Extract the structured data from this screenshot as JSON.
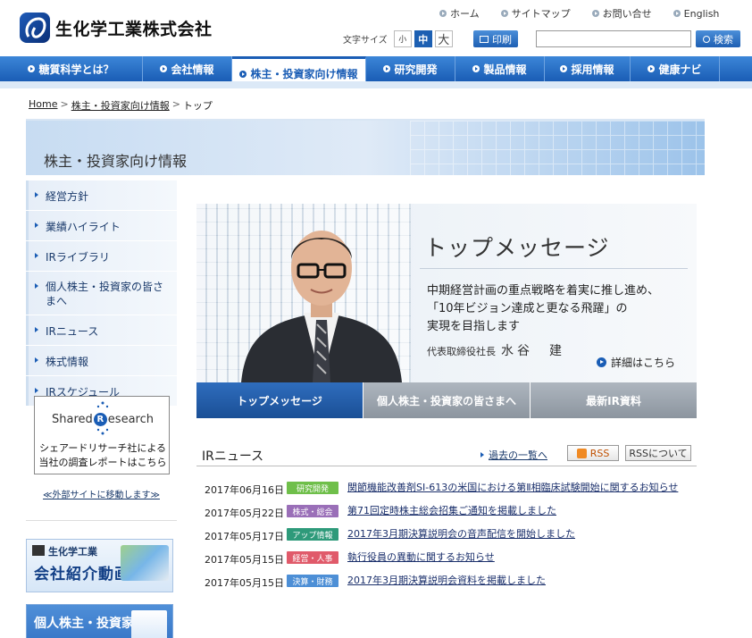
{
  "header": {
    "company_name": "生化学工業株式会社",
    "util_links": [
      {
        "label": "ホーム"
      },
      {
        "label": "サイトマップ"
      },
      {
        "label": "お問い合せ"
      },
      {
        "label": "English"
      }
    ],
    "font_size_label": "文字サイズ",
    "font_sizes": [
      "小",
      "中",
      "大"
    ],
    "print_label": "印刷",
    "search_placeholder": "",
    "search_button": "検索"
  },
  "gnav": {
    "items": [
      {
        "label": "糖質科学とは？"
      },
      {
        "label": "会社情報"
      },
      {
        "label": "株主・投資家向け情報"
      },
      {
        "label": "研究開発"
      },
      {
        "label": "製品情報"
      },
      {
        "label": "採用情報"
      },
      {
        "label": "健康ナビ"
      }
    ]
  },
  "breadcrumb": {
    "home": "Home",
    "parent": "株主・投資家向け情報",
    "current": "トップ",
    "separator": ">"
  },
  "page_title": "株主・投資家向け情報",
  "sidenav": {
    "items": [
      {
        "label": "経営方針"
      },
      {
        "label": "業績ハイライト"
      },
      {
        "label": "IRライブラリ"
      },
      {
        "label": "個人株主・投資家の皆さまへ"
      },
      {
        "label": "IRニュース"
      },
      {
        "label": "株式情報"
      },
      {
        "label": "IRスケジュール"
      }
    ]
  },
  "shared_research": {
    "logo_prefix": "Shared",
    "logo_r": "R",
    "logo_suffix": "esearch",
    "text_line1": "シェアードリサーチ社による",
    "text_line2": "当社の調査レポートはこちら",
    "external_note": "≪外部サイトに移動します≫"
  },
  "banners": {
    "video_line1": "生化学工業",
    "video_line2": "会社紹介動画",
    "investor_line1": "個人株主・投資家"
  },
  "main_visual": {
    "title": "トップメッセージ",
    "text_line1": "中期経営計画の重点戦略を着実に推し進め、",
    "text_line2": "「10年ビジョン達成と更なる飛躍」の",
    "text_line3": "実現を目指します",
    "sign_title": "代表取締役社長",
    "sign_name": "水谷　建",
    "more_label": "詳細はこちら"
  },
  "tabs": [
    {
      "label": "トップメッセージ",
      "active": true
    },
    {
      "label": "個人株主・投資家の皆さまへ",
      "active": false
    },
    {
      "label": "最新IR資料",
      "active": false
    }
  ],
  "news": {
    "title": "IRニュース",
    "past_label": "過去の一覧へ",
    "rss_label": "RSS",
    "rss_about_label": "RSSについて",
    "items": [
      {
        "date": "2017年06月16日",
        "category": "研究開発",
        "color": "#6fbf4a",
        "title": "関節機能改善剤SI-613の米国における第Ⅱ相臨床試験開始に関するお知らせ"
      },
      {
        "date": "2017年05月22日",
        "category": "株式・総会",
        "color": "#9a6fb8",
        "title": "第71回定時株主総会招集ご通知を掲載しました"
      },
      {
        "date": "2017年05月17日",
        "category": "アップ情報",
        "color": "#2e9a7a",
        "title": "2017年3月期決算説明会の音声配信を開始しました"
      },
      {
        "date": "2017年05月15日",
        "category": "経営・人事",
        "color": "#e05a6a",
        "title": "執行役員の異動に関するお知らせ"
      },
      {
        "date": "2017年05月15日",
        "category": "決算・財務",
        "color": "#4d8fd6",
        "title": "2017年3月期決算説明会資料を掲載しました"
      }
    ]
  }
}
